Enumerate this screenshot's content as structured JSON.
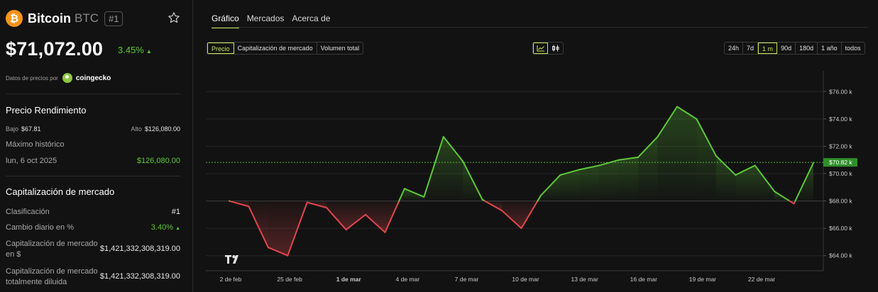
{
  "coin": {
    "logo_glyph": "₿",
    "name": "Bitcoin",
    "symbol": "BTC",
    "rank_badge": "#1",
    "price": "$71,072.00",
    "change": "3.45%",
    "change_arrow": "▲"
  },
  "source": {
    "label": "Datos de precios por",
    "name": "coingecko"
  },
  "performance": {
    "title": "Precio Rendimiento",
    "low_label": "Bajo",
    "low_value": "$67.81",
    "high_label": "Alto",
    "high_value": "$126,080.00",
    "ath_label": "Máximo histórico",
    "ath_date": "lun, 6 oct 2025",
    "ath_value": "$126,080.00"
  },
  "market_cap": {
    "title": "Capitalización de mercado",
    "rank_label": "Clasificación",
    "rank_value": "#1",
    "daily_label": "Cambio diario en %",
    "daily_value": "3.40%",
    "daily_arrow": "▲",
    "cap_usd_label": "Capitalización de mercado en $",
    "cap_usd_value": "$1,421,332,308,319.00",
    "fdv_label": "Capitalización de mercado totalmente diluida",
    "fdv_value": "$1,421,332,308,319.00"
  },
  "tabs": [
    {
      "label": "Gráfico",
      "active": true
    },
    {
      "label": "Mercados",
      "active": false
    },
    {
      "label": "Acerca de",
      "active": false
    }
  ],
  "metric_buttons": [
    {
      "label": "Precio",
      "active": true
    },
    {
      "label": "Capitalización de mercado",
      "active": false
    },
    {
      "label": "Volumen total",
      "active": false
    }
  ],
  "chart_modes": [
    {
      "icon": "line-chart-icon",
      "active": true
    },
    {
      "icon": "candlestick-icon",
      "active": false
    }
  ],
  "ranges": [
    {
      "label": "24h",
      "active": false
    },
    {
      "label": "7d",
      "active": false
    },
    {
      "label": "1 m",
      "active": true
    },
    {
      "label": "90d",
      "active": false
    },
    {
      "label": "180d",
      "active": false
    },
    {
      "label": "1 año",
      "active": false
    },
    {
      "label": "todos",
      "active": false
    }
  ],
  "colors": {
    "up": "#5ec83a",
    "down": "#e0474c",
    "accent": "#c4e65a",
    "bitcoin": "#f7931a"
  },
  "chart_data": {
    "type": "line",
    "x_ticks": [
      "2 de feb",
      "25 de feb",
      "1 de mar",
      "4 de mar",
      "7 de mar",
      "10 de mar",
      "13 de mar",
      "16 de mar",
      "19 de mar",
      "22 de mar"
    ],
    "bold_tick": "1 de mar",
    "y_ticks": [
      "$76.00 k",
      "$74.00 k",
      "$72.00 k",
      "$70.00 k",
      "$68.00 k",
      "$66.00 k",
      "$64.00 k"
    ],
    "ylim": [
      63000,
      77000
    ],
    "baseline": 68000,
    "current_value": 70820,
    "current_label": "$70.82 k",
    "series": [
      {
        "values": [
          68000,
          67600,
          64600,
          64000,
          67900,
          67500,
          65900,
          67000,
          65700,
          68900,
          68300,
          72700,
          70900,
          68100,
          67300,
          66000,
          68400,
          69900,
          70300,
          70600,
          71000,
          71200,
          72700,
          74900,
          74000,
          71300,
          69900,
          70600,
          68700,
          67800,
          70800
        ]
      }
    ],
    "grid": true
  }
}
